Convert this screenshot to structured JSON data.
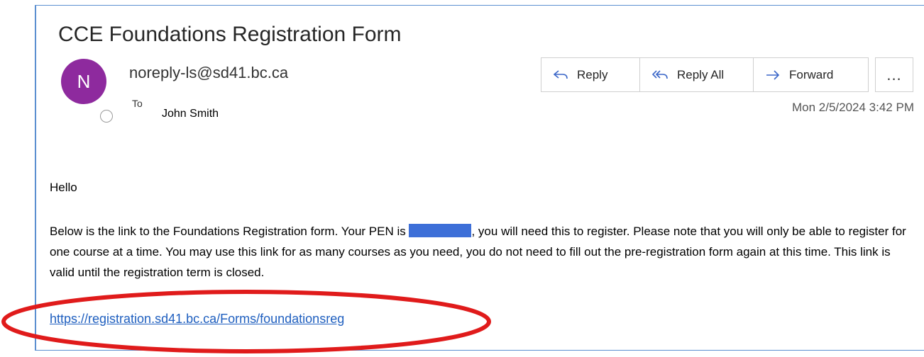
{
  "email": {
    "subject": "CCE Foundations Registration Form",
    "avatar_initial": "N",
    "avatar_color": "#8e2a9e",
    "sender": "noreply-ls@sd41.bc.ca",
    "to_label": "To",
    "to_name": "John Smith",
    "date": "Mon 2/5/2024 3:42 PM"
  },
  "actions": {
    "reply_label": "Reply",
    "reply_all_label": "Reply All",
    "forward_label": "Forward",
    "more_label": "..."
  },
  "body": {
    "greeting": "Hello",
    "para_part1": "Below is the link to the Foundations Registration form. Your PEN is ",
    "para_part2": ", you will need this to register. Please note that you will only be able to register for one course at a time. You may use this link for as many courses as you need, you do not need to fill out the pre-registration form again at this time. This link is valid until the registration term is closed.",
    "link_text": "https://registration.sd41.bc.ca/Forms/foundationsreg"
  },
  "colors": {
    "link": "#1f5fbf",
    "redaction": "#3d6fd8",
    "annotation": "#e01b1b",
    "frame_border": "#5b8fd0"
  }
}
